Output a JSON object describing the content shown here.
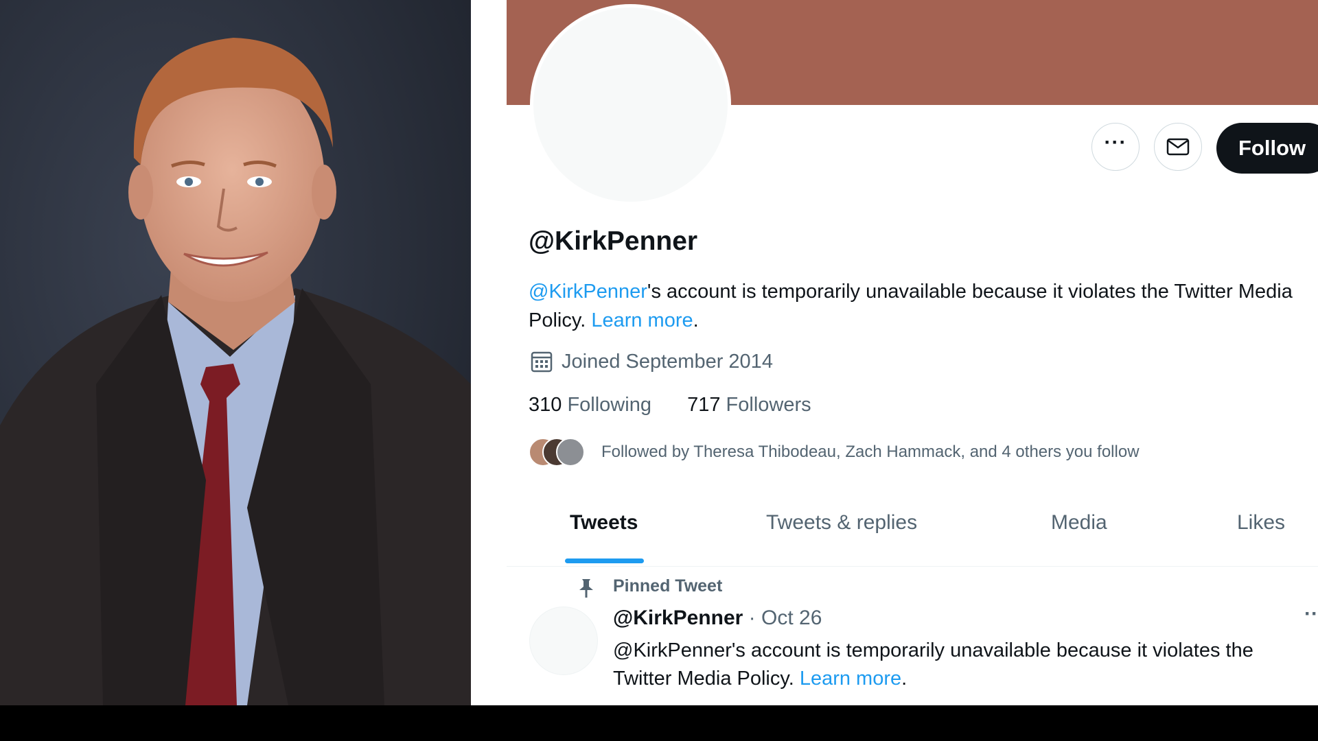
{
  "colors": {
    "banner": "#a46252",
    "link": "#1d9bf0",
    "follow_button": "#0f1419",
    "tab_indicator": "#1d9bf0"
  },
  "profile": {
    "handle": "@KirkPenner",
    "bio_mention": "@KirkPenner",
    "bio_text": "'s account is temporarily unavailable because it violates the Twitter Media Policy.",
    "bio_link": "Learn more",
    "bio_end": ".",
    "joined": "Joined September 2014",
    "following_count": "310",
    "following_label": "Following",
    "followers_count": "717",
    "followers_label": "Followers",
    "followed_by": "Followed by Theresa Thibodeau, Zach Hammack, and 4 others you follow"
  },
  "buttons": {
    "follow": "Follow",
    "more_icon": "more-icon",
    "message_icon": "envelope-icon"
  },
  "tabs": [
    "Tweets",
    "Tweets & replies",
    "Media",
    "Likes"
  ],
  "pinned": {
    "label": "Pinned Tweet",
    "icon": "pin-icon",
    "author": "@KirkPenner",
    "separator": " · ",
    "date": "Oct 26",
    "text": "@KirkPenner's account is temporarily unavailable because it violates the Twitter Media Policy. ",
    "link": "Learn more",
    "end": "."
  }
}
